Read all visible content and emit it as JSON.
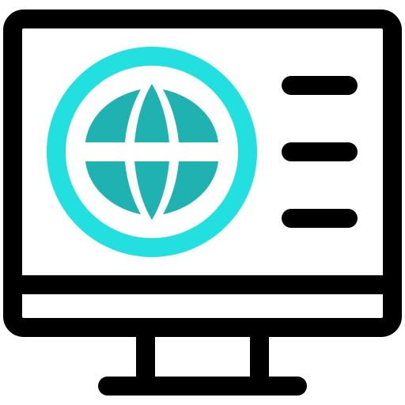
{
  "icon": {
    "name": "computer-monitor-globe-icon",
    "parts": [
      "monitor-icon",
      "globe-icon",
      "menu-lines-icon",
      "monitor-stand-icon"
    ]
  },
  "colors": {
    "outline": "#000000",
    "globe_ring": "#22e0e0",
    "globe_fill": "#20b2b0",
    "background": "#ffffff"
  }
}
